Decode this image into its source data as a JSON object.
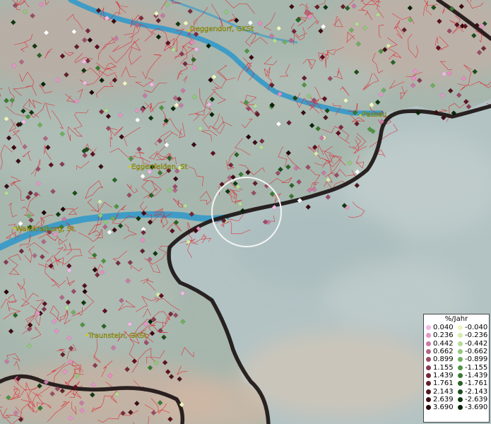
{
  "cities": [
    {
      "name": "Deggendorf, GKSt"
    },
    {
      "name": "Passau"
    },
    {
      "name": "Eggenfelden, St"
    },
    {
      "name": "Waldkraiburg, St"
    },
    {
      "name": "Traunstein, GKSt"
    }
  ],
  "legend": {
    "title": "%/Jahr",
    "positive": [
      {
        "value": "0.040",
        "color": "#f2b8e6"
      },
      {
        "value": "0.236",
        "color": "#e496c8"
      },
      {
        "value": "0.442",
        "color": "#c97aa5"
      },
      {
        "value": "0.662",
        "color": "#b26785"
      },
      {
        "value": "0.899",
        "color": "#9a4c66"
      },
      {
        "value": "1.155",
        "color": "#873a52"
      },
      {
        "value": "1.439",
        "color": "#732838"
      },
      {
        "value": "1.761",
        "color": "#62202b"
      },
      {
        "value": "2.143",
        "color": "#50161f"
      },
      {
        "value": "2.639",
        "color": "#3c0d14"
      },
      {
        "value": "3.690",
        "color": "#25060a"
      }
    ],
    "negative": [
      {
        "value": "-0.040",
        "color": "#eef5bf"
      },
      {
        "value": "-0.236",
        "color": "#d4ecad"
      },
      {
        "value": "-0.442",
        "color": "#b4dc98"
      },
      {
        "value": "-0.662",
        "color": "#93c87b"
      },
      {
        "value": "-0.899",
        "color": "#6fae5e"
      },
      {
        "value": "-1.155",
        "color": "#4f9443"
      },
      {
        "value": "-1.439",
        "color": "#397a31"
      },
      {
        "value": "-1.761",
        "color": "#286324"
      },
      {
        "value": "-2.143",
        "color": "#1a4c18"
      },
      {
        "value": "-2.639",
        "color": "#10380f"
      },
      {
        "value": "-3.690",
        "color": "#072407"
      }
    ]
  }
}
